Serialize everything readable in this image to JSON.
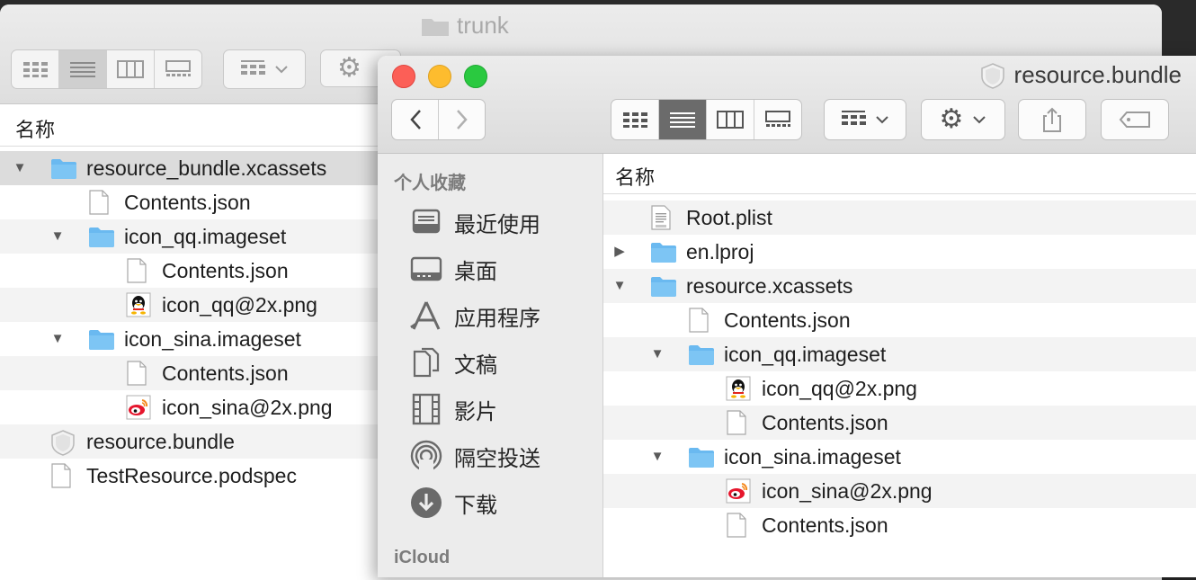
{
  "back_window": {
    "title": "trunk",
    "column_header": "名称",
    "rows": [
      {
        "label": "resource_bundle.xcassets",
        "icon": "folder-icon",
        "disclosure": "open"
      },
      {
        "label": "Contents.json",
        "icon": "file-icon",
        "disclosure": ""
      },
      {
        "label": "icon_qq.imageset",
        "icon": "folder-icon",
        "disclosure": "open"
      },
      {
        "label": "Contents.json",
        "icon": "file-icon",
        "disclosure": ""
      },
      {
        "label": "icon_qq@2x.png",
        "icon": "qq-image-icon",
        "disclosure": ""
      },
      {
        "label": "icon_sina.imageset",
        "icon": "folder-icon",
        "disclosure": "open"
      },
      {
        "label": "Contents.json",
        "icon": "file-icon",
        "disclosure": ""
      },
      {
        "label": "icon_sina@2x.png",
        "icon": "sina-image-icon",
        "disclosure": ""
      },
      {
        "label": "resource.bundle",
        "icon": "bundle-icon",
        "disclosure": ""
      },
      {
        "label": "TestResource.podspec",
        "icon": "file-icon",
        "disclosure": ""
      }
    ]
  },
  "front_window": {
    "title": "resource.bundle",
    "column_header": "名称",
    "sidebar": {
      "favorites_heading": "个人收藏",
      "items": [
        {
          "label": "最近使用",
          "icon": "recents-icon"
        },
        {
          "label": "桌面",
          "icon": "desktop-icon"
        },
        {
          "label": "应用程序",
          "icon": "applications-icon"
        },
        {
          "label": "文稿",
          "icon": "documents-icon"
        },
        {
          "label": "影片",
          "icon": "movies-icon"
        },
        {
          "label": "隔空投送",
          "icon": "airdrop-icon"
        },
        {
          "label": "下载",
          "icon": "downloads-icon"
        }
      ],
      "icloud_heading": "iCloud"
    },
    "rows": [
      {
        "label": "Root.plist",
        "icon": "plist-icon",
        "disclosure": ""
      },
      {
        "label": "en.lproj",
        "icon": "folder-icon",
        "disclosure": "closed"
      },
      {
        "label": "resource.xcassets",
        "icon": "folder-icon",
        "disclosure": "open"
      },
      {
        "label": "Contents.json",
        "icon": "file-icon",
        "disclosure": ""
      },
      {
        "label": "icon_qq.imageset",
        "icon": "folder-icon",
        "disclosure": "open"
      },
      {
        "label": "icon_qq@2x.png",
        "icon": "qq-image-icon",
        "disclosure": ""
      },
      {
        "label": "Contents.json",
        "icon": "file-icon",
        "disclosure": ""
      },
      {
        "label": "icon_sina.imageset",
        "icon": "folder-icon",
        "disclosure": "open"
      },
      {
        "label": "icon_sina@2x.png",
        "icon": "sina-image-icon",
        "disclosure": ""
      },
      {
        "label": "Contents.json",
        "icon": "file-icon",
        "disclosure": ""
      }
    ]
  },
  "colors": {
    "close": "#fc5f57",
    "minimize": "#fdbc2e",
    "zoom": "#2ac940",
    "folder": "#6ab9f0"
  }
}
